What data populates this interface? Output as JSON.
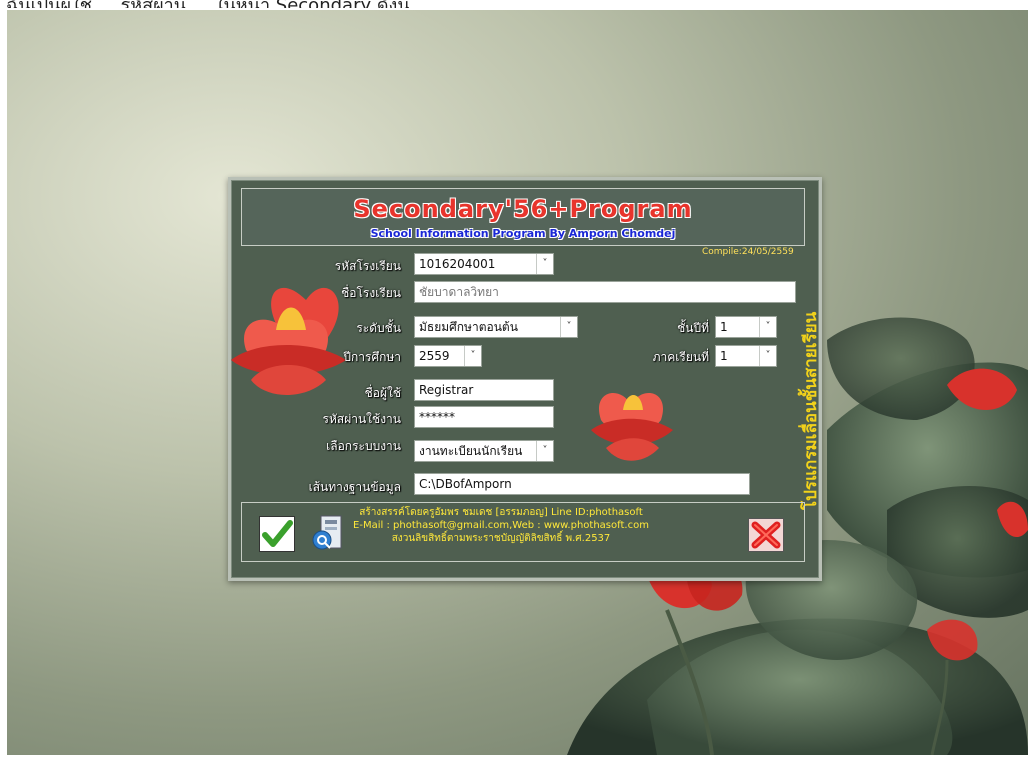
{
  "top_caption": "ฉันเป็นผู้ใช้ ... รหัสผ่าน ... ในหน้า Secondary ดังนี้ ...",
  "dialog": {
    "title": "Secondary'56+Program",
    "subtitle": "School Information Program By Amporn Chomdej",
    "compile": "Compile:24/05/2559",
    "vertical_text": "โปรแกรมเลื่อนชั้นสายเรียน",
    "fields": {
      "school_code": {
        "label": "รหัสโรงเรียน",
        "value": "1016204001"
      },
      "school_name": {
        "label": "ชื่อโรงเรียน",
        "placeholder": "ชัยบาดาลวิทยา"
      },
      "level": {
        "label": "ระดับชั้น",
        "value": "มัธยมศึกษาตอนต้น"
      },
      "grade": {
        "label": "ชั้นปีที่",
        "value": "1"
      },
      "academic_year": {
        "label": "ปีการศึกษา",
        "value": "2559"
      },
      "semester": {
        "label": "ภาคเรียนที่",
        "value": "1"
      },
      "username": {
        "label": "ชื่อผู้ใช้",
        "value": "Registrar"
      },
      "password": {
        "label": "รหัสผ่านใช้งาน",
        "value": "******"
      },
      "system": {
        "label": "เลือกระบบงาน",
        "value": "งานทะเบียนนักเรียน"
      },
      "db_path": {
        "label": "เส้นทางฐานข้อมูล",
        "value": "C:\\DBofAmporn"
      }
    },
    "footer_lines": [
      "สร้างสรรค์โดยครูอัมพร ชมเดช [อรรมภอญ] Line ID:phothasoft",
      "E-Mail : phothasoft@gmail.com,Web : www.phothasoft.com",
      "สงวนลิขสิทธิ์ตามพระราชบัญญัติลิขสิทธิ์ พ.ศ.2537"
    ],
    "dropdown_glyph": "˅"
  },
  "colors": {
    "title_red": "#e8342c",
    "subtitle_blue": "#1a27d6",
    "accent_yellow": "#ffe83a",
    "dialog_bg": "#4f5f50"
  },
  "icons": {
    "ok": "checkmark-icon",
    "about": "help-book-icon",
    "close": "red-x-icon"
  }
}
